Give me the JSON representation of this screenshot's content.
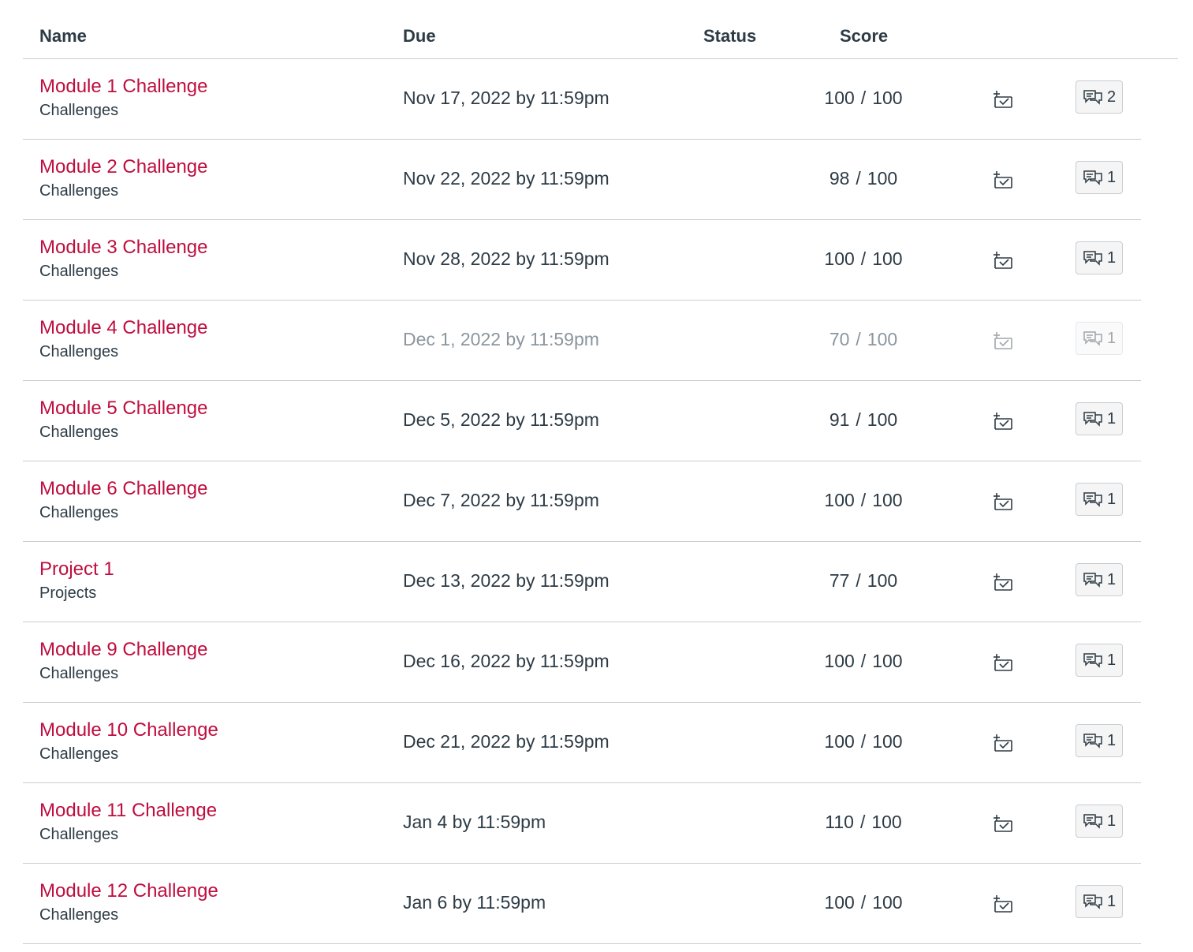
{
  "table": {
    "headers": {
      "name": "Name",
      "due": "Due",
      "status": "Status",
      "score": "Score"
    },
    "rows": [
      {
        "name": "Module 1 Challenge",
        "category": "Challenges",
        "due": "Nov 17, 2022 by 11:59pm",
        "score": "100",
        "possible": "100",
        "comments": "2"
      },
      {
        "name": "Module 2 Challenge",
        "category": "Challenges",
        "due": "Nov 22, 2022 by 11:59pm",
        "score": "98",
        "possible": "100",
        "comments": "1"
      },
      {
        "name": "Module 3 Challenge",
        "category": "Challenges",
        "due": "Nov 28, 2022 by 11:59pm",
        "score": "100",
        "possible": "100",
        "comments": "1"
      },
      {
        "name": "Module 4 Challenge",
        "category": "Challenges",
        "due": "Dec 1, 2022 by 11:59pm",
        "score": "70",
        "possible": "100",
        "comments": "1"
      },
      {
        "name": "Module 5 Challenge",
        "category": "Challenges",
        "due": "Dec 5, 2022 by 11:59pm",
        "score": "91",
        "possible": "100",
        "comments": "1"
      },
      {
        "name": "Module 6 Challenge",
        "category": "Challenges",
        "due": "Dec 7, 2022 by 11:59pm",
        "score": "100",
        "possible": "100",
        "comments": "1"
      },
      {
        "name": "Project 1",
        "category": "Projects",
        "due": "Dec 13, 2022 by 11:59pm",
        "score": "77",
        "possible": "100",
        "comments": "1"
      },
      {
        "name": "Module 9 Challenge",
        "category": "Challenges",
        "due": "Dec 16, 2022 by 11:59pm",
        "score": "100",
        "possible": "100",
        "comments": "1"
      },
      {
        "name": "Module 10 Challenge",
        "category": "Challenges",
        "due": "Dec 21, 2022 by 11:59pm",
        "score": "100",
        "possible": "100",
        "comments": "1"
      },
      {
        "name": "Module 11 Challenge",
        "category": "Challenges",
        "due": "Jan 4 by 11:59pm",
        "score": "110",
        "possible": "100",
        "comments": "1"
      },
      {
        "name": "Module 12 Challenge",
        "category": "Challenges",
        "due": "Jan 6 by 11:59pm",
        "score": "100",
        "possible": "100",
        "comments": "1"
      }
    ]
  },
  "colors": {
    "link": "#bf0d3e",
    "text": "#2d3b45",
    "muted": "#8b969e",
    "border": "#c7cdd1"
  },
  "icons": {
    "whatif": "whatif-grade-icon",
    "comment": "comment-icon"
  },
  "muted_rows": [
    3
  ]
}
